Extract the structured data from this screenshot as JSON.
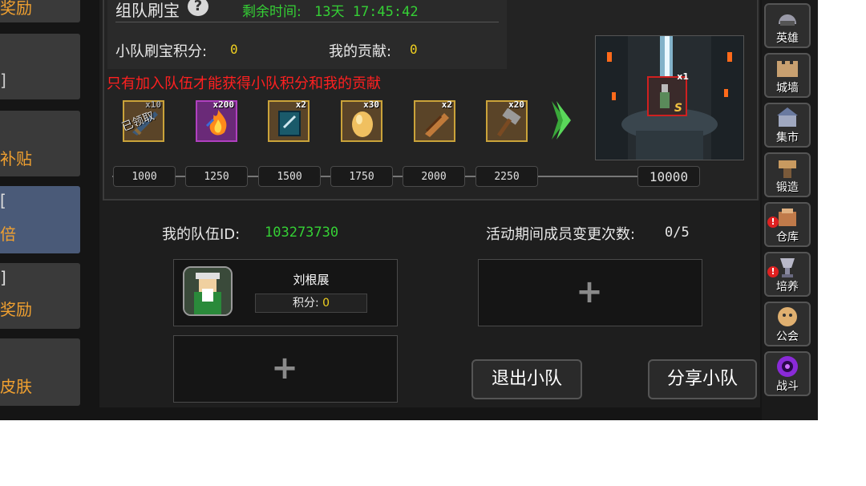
{
  "left_tabs": [
    {
      "line1": "",
      "line2": "奖励"
    },
    {
      "line1": "",
      "line2": "]"
    },
    {
      "line1": "",
      "line2": "补贴"
    },
    {
      "line1": "[",
      "line2": "倍"
    },
    {
      "line1": "]",
      "line2": "奖励"
    },
    {
      "line1": "",
      "line2": "皮肤"
    }
  ],
  "header": {
    "title": "组队刷宝",
    "help_glyph": "?",
    "timer_label": "剩余时间:",
    "timer_value": "13天 17:45:42",
    "team_points_label": "小队刷宝积分:",
    "team_points_value": "0",
    "my_contribution_label": "我的贡献:",
    "my_contribution_value": "0",
    "warning": "只有加入队伍才能获得小队积分和我的贡献"
  },
  "rewards": [
    {
      "count": "x10",
      "icon": "sword-icon",
      "claimed_text": "已领取"
    },
    {
      "count": "x200",
      "icon": "flame-icon"
    },
    {
      "count": "x2",
      "icon": "book-icon"
    },
    {
      "count": "x30",
      "icon": "egg-icon"
    },
    {
      "count": "x2",
      "icon": "scroll-icon"
    },
    {
      "count": "x20",
      "icon": "hammer-icon"
    }
  ],
  "milestones": [
    "1000",
    "1250",
    "1500",
    "1750",
    "2000",
    "2250"
  ],
  "final_milestone": "10000",
  "final_reward": {
    "count": "x1",
    "icon": "statue-icon",
    "badge": "S"
  },
  "team": {
    "id_label": "我的队伍ID:",
    "id_value": "103273730",
    "changes_label": "活动期间成员变更次数:",
    "changes_value": "0/5",
    "member": {
      "name": "刘根展",
      "score_label": "积分:",
      "score_value": "0"
    },
    "plus": "+",
    "leave_button": "退出小队",
    "share_button": "分享小队"
  },
  "sidebar": [
    {
      "label": "英雄",
      "icon": "helmet-icon",
      "badge": ""
    },
    {
      "label": "城墙",
      "icon": "wall-icon",
      "badge": ""
    },
    {
      "label": "集市",
      "icon": "market-icon",
      "badge": ""
    },
    {
      "label": "锻造",
      "icon": "anvil-icon",
      "badge": ""
    },
    {
      "label": "仓库",
      "icon": "warehouse-icon",
      "badge": "!"
    },
    {
      "label": "培养",
      "icon": "trophy-icon",
      "badge": "!"
    },
    {
      "label": "公会",
      "icon": "guild-icon",
      "badge": ""
    },
    {
      "label": "战斗",
      "icon": "portal-icon",
      "badge": ""
    }
  ],
  "colors": {
    "green": "#35d035",
    "yellow": "#f0d020",
    "red": "#ff2020",
    "orange": "#f0a030"
  }
}
